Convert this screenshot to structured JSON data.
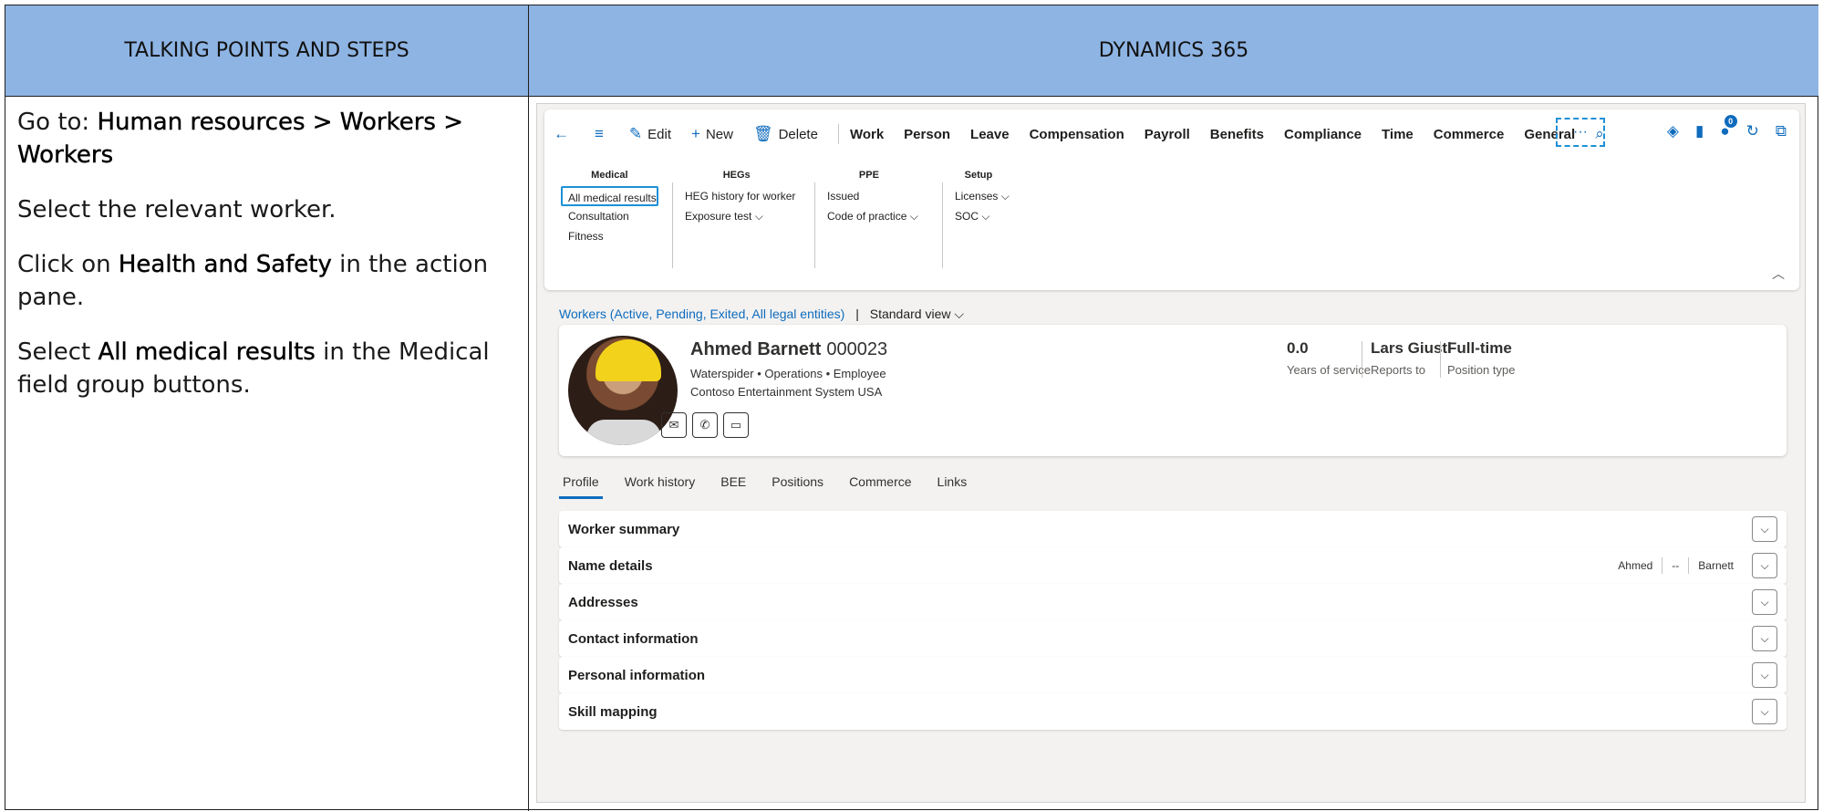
{
  "headers": {
    "left": "TALKING POINTS AND STEPS",
    "right": "DYNAMICS 365"
  },
  "steps": {
    "s1_prefix": "Go to: ",
    "s1_bold": "Human resources > Workers > Workers",
    "s2": "Select the relevant worker.",
    "s3_prefix": "Click on ",
    "s3_bold": "Health and Safety",
    "s3_suffix": " in the action pane.",
    "s4_prefix": "Select ",
    "s4_bold": "All medical results",
    "s4_suffix": " in the Medical field group buttons."
  },
  "action_pane": {
    "edit": "Edit",
    "new": "New",
    "delete": "Delete",
    "tabs": [
      "Work",
      "Person",
      "Leave",
      "Compensation",
      "Payroll",
      "Benefits",
      "Compliance",
      "Time",
      "Commerce",
      "General"
    ],
    "more": "···",
    "badge": "0",
    "groups": {
      "medical": {
        "title": "Medical",
        "items": [
          "All medical results",
          "Consultation",
          "Fitness"
        ]
      },
      "hegs": {
        "title": "HEGs",
        "items": [
          "HEG history for worker",
          "Exposure test"
        ]
      },
      "ppe": {
        "title": "PPE",
        "items": [
          "Issued",
          "Code of practice"
        ]
      },
      "setup": {
        "title": "Setup",
        "items": [
          "Licenses",
          "SOC"
        ]
      }
    }
  },
  "breadcrumb": {
    "link": "Workers (Active, Pending, Exited, All legal entities)",
    "sep": "|",
    "view": "Standard view"
  },
  "worker": {
    "name": "Ahmed Barnett",
    "id": "000023",
    "role": "Waterspider  •  Operations  •  Employee",
    "company": "Contoso Entertainment System USA",
    "stats": [
      {
        "value": "0.0",
        "label": "Years of service"
      },
      {
        "value": "Lars Giusti",
        "label": "Reports to"
      },
      {
        "value": "Full-time",
        "label": "Position type"
      }
    ]
  },
  "tabs": [
    "Profile",
    "Work history",
    "BEE",
    "Positions",
    "Commerce",
    "Links"
  ],
  "sections": [
    "Worker summary",
    "Name details",
    "Addresses",
    "Contact information",
    "Personal information",
    "Skill mapping"
  ],
  "name_details": {
    "first": "Ahmed",
    "middle": "--",
    "last": "Barnett"
  },
  "icons": {
    "back": "arrow-left-icon",
    "menu": "menu-icon",
    "edit": "pencil-icon",
    "new": "plus-icon",
    "delete": "trash-icon",
    "search": "search-icon",
    "diamond": "diamond-icon",
    "office": "office-icon",
    "chat": "chat-badge-icon",
    "refresh": "refresh-icon",
    "popout": "popout-icon",
    "mail": "mail-icon",
    "phone": "phone-icon",
    "message": "message-icon"
  },
  "colors": {
    "header_bg": "#8eb4e3",
    "accent": "#0f6cbd"
  }
}
